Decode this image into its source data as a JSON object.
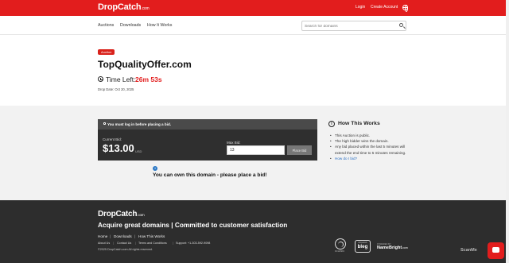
{
  "header": {
    "logo_main": "DropCatch",
    "logo_suffix": ".com",
    "login": "Login",
    "create_account": "Create Account"
  },
  "nav": {
    "auctions": "Auctions",
    "downloads": "Downloads",
    "how_it_works": "How It Works",
    "search_placeholder": "Search for domains"
  },
  "auction": {
    "badge": "Auction",
    "domain": "TopQualityOffer.com",
    "time_left_label": "Time Left:",
    "time_left_value": "26m 53s",
    "drop_date": "Drop Date: Oct 20, 2025"
  },
  "bid_panel": {
    "login_notice": "You must log in before placing a bid.",
    "current_bid_label": "Current Bid:",
    "current_bid_value": "$13.00",
    "currency": "USD",
    "max_bid_label": "Max Bid:",
    "max_bid_value": "13",
    "place_bid_label": "Place Bid"
  },
  "ownership": {
    "info_glyph": "i",
    "message": "You can own this domain - please place a bid!"
  },
  "how_this_works": {
    "icon_glyph": "i",
    "title": "How This Works",
    "items": [
      "This Auction is public.",
      "The high bidder wins the domain.",
      "Any bid placed within the last 5 minutes will extend the end time to 5 minutes remaining.",
      "How do I bid?"
    ]
  },
  "footer": {
    "logo_main": "DropCatch",
    "logo_suffix": ".com",
    "tagline": "Acquire great domains | Committed to customer satisfaction",
    "nav": [
      "Home",
      "Downloads",
      "How This Works"
    ],
    "separator": "|",
    "links": [
      "About Us",
      "Contact Us",
      "Terms and Conditions",
      "Support: +1-303-592-9098"
    ],
    "copyright": "©2025 DropCatch.com All rights reserved.",
    "icann_text": "ICANN",
    "bleg_top": "dropcatch",
    "bleg_main": "bleg",
    "namebright_powered": "POWERED BY",
    "namebright_main": "NameBright",
    "namebright_suffix": ".com"
  },
  "overlay": {
    "watermark": "ScanMe"
  },
  "colors": {
    "brand_red": "#e21d1d",
    "panel_dark": "#2f2f2f",
    "footer_bg": "#2d2d2d",
    "link_blue": "#2b6fc2"
  }
}
